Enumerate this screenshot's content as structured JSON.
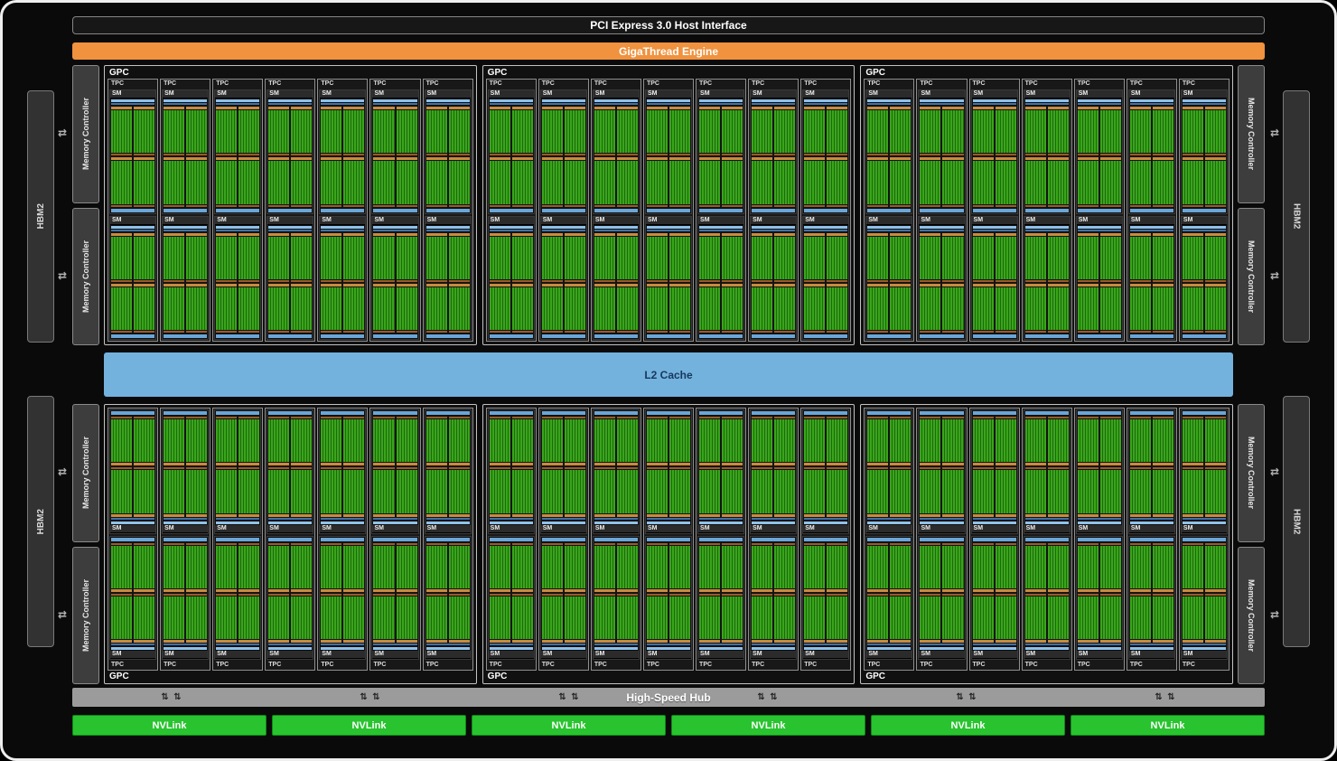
{
  "pci": {
    "label": "PCI Express 3.0 Host Interface"
  },
  "gigathread": {
    "label": "GigaThread Engine"
  },
  "l2_cache": {
    "label": "L2 Cache"
  },
  "hub": {
    "label": "High-Speed Hub"
  },
  "nvlink": {
    "label": "NVLink",
    "count": 6
  },
  "memory": {
    "hbm2_label": "HBM2",
    "hbm2_per_side": 2,
    "controller_label": "Memory Controller",
    "controllers_per_side": 4
  },
  "gpc": {
    "label": "GPC",
    "count": 6,
    "per_row": 3,
    "tpc_label": "TPC",
    "tpc_per_gpc": 7,
    "sm_label": "SM",
    "sm_per_tpc": 2
  },
  "icons": {
    "mem_arrow": "⇄",
    "hub_arrow": "⇅"
  },
  "colors": {
    "gigathread_orange": "#f0923e",
    "l2_blue": "#74b2de",
    "nvlink_green": "#28c32e",
    "hub_gray": "#9b9b9b",
    "core_green": "#3aa51b",
    "sm_blue": "#6aa6d8",
    "register_tan": "#c98a3f"
  }
}
